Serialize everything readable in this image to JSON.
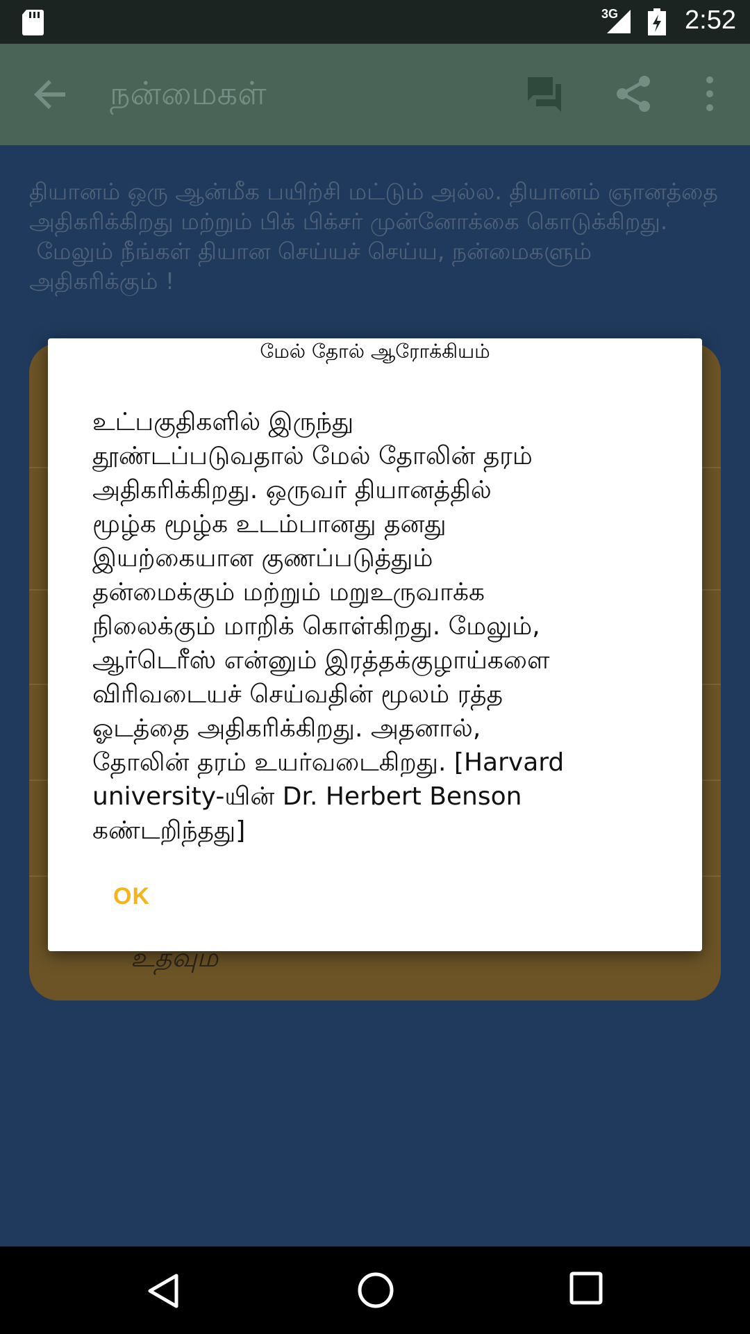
{
  "status_bar": {
    "network": "3G",
    "time": "2:52",
    "icons": [
      "sd-card-icon",
      "signal-icon",
      "battery-icon"
    ]
  },
  "app_bar": {
    "title": "நன்மைகள்",
    "icons": [
      "back-arrow-icon",
      "chat-icon",
      "share-icon",
      "more-vert-icon"
    ]
  },
  "content": {
    "intro": "தியானம் ஒரு ஆன்மீக பயிற்சி மட்டும் அல்ல. தியானம் ஞானத்தை அதிகரிக்கிறது மற்றும் பிக் பிக்சர் முன்னோக்கை கொடுக்கிறது.\n மேலும் நீங்கள் தியான செய்யச் செய்ய, நன்மைகளும் அதிகரிக்கும் !",
    "card_last_item": "உதவும்"
  },
  "dialog": {
    "title": "மேல் தோல் ஆரோக்கியம்",
    "body": "உட்பகுதிகளில் இருந்து\nதூண்டப்படுவதால் மேல் தோலின் தரம்\nஅதிகரிக்கிறது. ஒருவர் தியானத்தில்\nமூழ்க மூழ்க உடம்பானது தனது\nஇயற்கையான குணப்படுத்தும்\nதன்மைக்கும் மற்றும் மறுஉருவாக்க\nநிலைக்கும் மாறிக் கொள்கிறது. மேலும்,\nஆர்டெரீஸ் என்னும் இரத்தக்குழாய்களை\nவிரிவடையச் செய்வதின் மூலம் ரத்த\nஓடத்தை அதிகரிக்கிறது. அதனால்,\nதோலின் தரம் உயர்வடைகிறது. [Harvard\nuniversity-யின் Dr. Herbert Benson\nகண்டறிந்தது]",
    "ok_label": "OK"
  },
  "colors": {
    "background": "#1f3a5c",
    "app_bar": "#4a6457",
    "card": "#6c5427",
    "accent": "#f4b51c"
  }
}
